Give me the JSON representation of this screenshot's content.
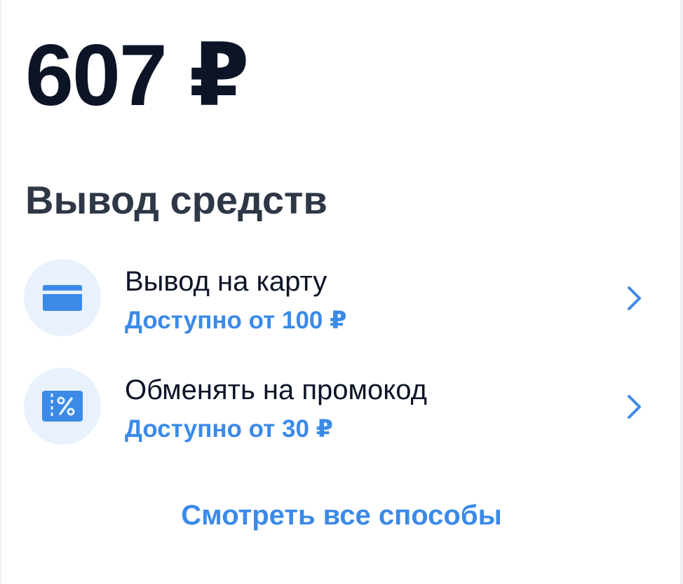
{
  "balance": {
    "amount": "607 ₽"
  },
  "withdrawal": {
    "title": "Вывод средств",
    "methods": [
      {
        "title": "Вывод на карту",
        "subtitle": "Доступно от 100 ₽",
        "icon": "credit-card-icon"
      },
      {
        "title": "Обменять на промокод",
        "subtitle": "Доступно от 30 ₽",
        "icon": "promo-coupon-icon"
      }
    ],
    "see_all_label": "Смотреть все способы"
  },
  "colors": {
    "accent": "#3b8ae8",
    "icon_bg": "#e8f1fc",
    "text_dark": "#0c1426",
    "heading": "#2e3746"
  }
}
